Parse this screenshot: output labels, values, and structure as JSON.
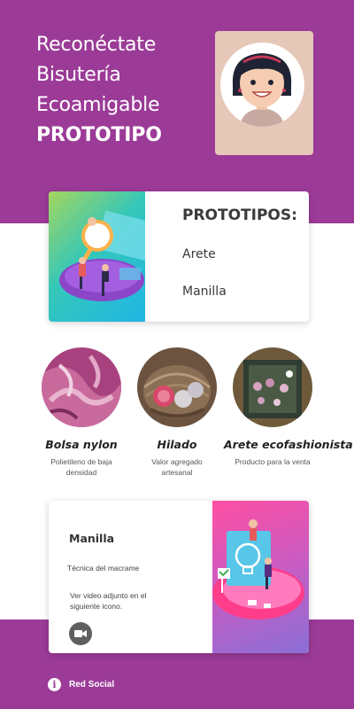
{
  "hero": {
    "line1": "Reconéctate",
    "line2": "Bisutería",
    "line3": "Ecoamigable",
    "line4": "PROTOTIPO"
  },
  "prototypes": {
    "heading": "PROTOTIPOS:",
    "items": [
      "Arete",
      "Manilla"
    ]
  },
  "products": [
    {
      "title": "Bolsa nylon",
      "desc_line1": "Polietileno de baja",
      "desc_line2": "densidad"
    },
    {
      "title": "Hilado",
      "desc_line1": "Valor agregado",
      "desc_line2": "artesanal"
    },
    {
      "title": "Arete ecofashionista",
      "desc_line1": "Producto para la venta",
      "desc_line2": ""
    }
  ],
  "manilla": {
    "title": "Manilla",
    "subtitle": "Técnica del macrame",
    "note_line1": "Ver video adjunto en el",
    "note_line2": "siguiente icono.",
    "video_icon": "video-camera-icon"
  },
  "footer": {
    "social_label": "Red Social",
    "icon": "info-icon"
  },
  "colors": {
    "brand_purple": "#9b3b97",
    "avatar_bg": "#e6c8b8"
  }
}
